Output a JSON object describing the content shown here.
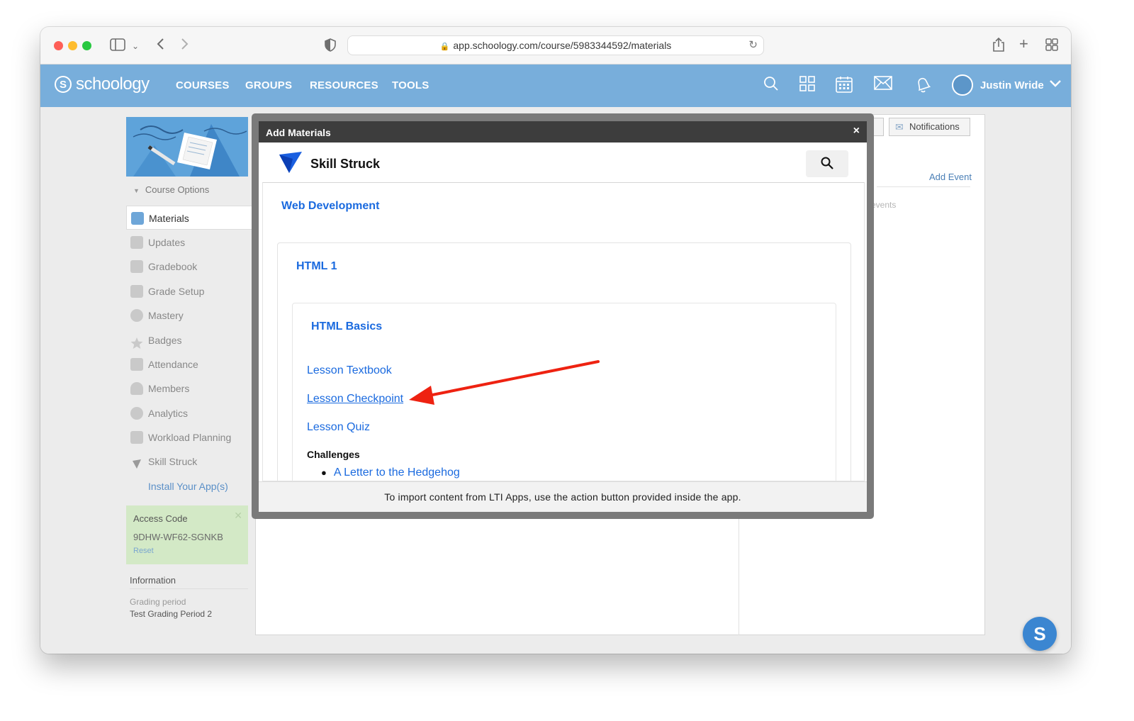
{
  "browser": {
    "url": "app.schoology.com/course/5983344592/materials"
  },
  "header": {
    "logo_text": "schoology",
    "logo_mark": "S",
    "nav": [
      "COURSES",
      "GROUPS",
      "RESOURCES",
      "TOOLS"
    ],
    "user_name": "Justin Wride"
  },
  "sidebar": {
    "course_options": "Course Options",
    "items": [
      {
        "label": "Materials",
        "icon": "materials-icon"
      },
      {
        "label": "Updates",
        "icon": "updates-icon"
      },
      {
        "label": "Gradebook",
        "icon": "gradebook-icon"
      },
      {
        "label": "Grade Setup",
        "icon": "grade-setup-icon"
      },
      {
        "label": "Mastery",
        "icon": "mastery-icon"
      },
      {
        "label": "Badges",
        "icon": "badges-icon"
      },
      {
        "label": "Attendance",
        "icon": "attendance-icon"
      },
      {
        "label": "Members",
        "icon": "members-icon"
      },
      {
        "label": "Analytics",
        "icon": "analytics-icon"
      },
      {
        "label": "Workload Planning",
        "icon": "workload-icon"
      },
      {
        "label": "Skill Struck",
        "icon": "skill-struck-icon"
      }
    ],
    "install_apps": "Install Your App(s)",
    "access_code": {
      "title": "Access Code",
      "code": "9DHW-WF62-SGNKB",
      "reset": "Reset"
    },
    "information": {
      "title": "Information",
      "grading_period_label": "Grading period",
      "grading_period_value": "Test Grading Period 2"
    }
  },
  "right_panel": {
    "notifications_label": "Notifications",
    "add_event": "Add Event",
    "events_text": "events"
  },
  "modal": {
    "title": "Add Materials",
    "close": "×",
    "app_name": "Skill Struck",
    "course": "Web Development",
    "unit": "HTML 1",
    "lesson": "HTML Basics",
    "links": [
      "Lesson Textbook",
      "Lesson Checkpoint",
      "Lesson Quiz"
    ],
    "challenges_label": "Challenges",
    "challenges": [
      "A Letter to the Hedgehog"
    ],
    "footer": "To import content from LTI Apps, use the action button provided inside the app."
  },
  "chat": {
    "letter": "S"
  },
  "colors": {
    "header_bg": "#78aedb",
    "link_blue": "#1a6adf",
    "annotation_arrow": "#ee2211",
    "access_bg": "#d3e9c6"
  }
}
